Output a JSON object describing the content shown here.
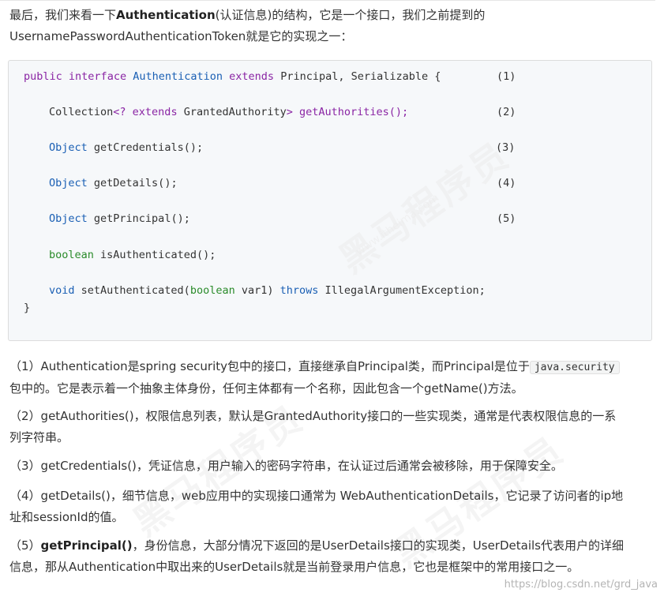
{
  "intro": {
    "part1": "最后，我们来看一下",
    "bold": "Authentication",
    "part2": "(认证信息)的结构，它是一个接口，我们之前提到的",
    "line2": "UsernamePasswordAuthenticationToken就是它的实现之一："
  },
  "code": {
    "l1": {
      "kw1": "public",
      "kw2": "interface",
      "type": "Authentication",
      "kw3": "extends",
      "rest": "Principal, Serializable {",
      "num": "(1)"
    },
    "l2": {
      "a": "Collection",
      "b": "<? ",
      "kw": "extends",
      "c": " GrantedAuthority",
      "d": "> getAuthorities();",
      "num": "(2)"
    },
    "l3": {
      "type": "Object",
      "rest": " getCredentials();",
      "num": "(3)"
    },
    "l4": {
      "type": "Object",
      "rest": " getDetails();",
      "num": "(4)"
    },
    "l5": {
      "type": "Object",
      "rest": " getPrincipal();",
      "num": "(5)"
    },
    "l6": {
      "type": "boolean",
      "rest": " isAuthenticated();"
    },
    "l7": {
      "type": "void",
      "rest1": " setAuthenticated(",
      "type2": "boolean",
      "rest2": " var1) ",
      "kw": "throws",
      "rest3": " IllegalArgumentException;"
    },
    "l8": "}"
  },
  "explanations": {
    "e1": {
      "a": "（1）Authentication是spring security包中的接口，直接继承自Principal类，而Principal是位于",
      "code": "java.security",
      "b": "包中的。它是表示着一个抽象主体身份，任何主体都有一个名称，因此包含一个getName()方法。"
    },
    "e2": {
      "a": "（2）getAuthorities()，权限信息列表，默认是GrantedAuthority接口的一些实现类，通常是代表权限信息的一系",
      "b": "列字符串。"
    },
    "e3": "（3）getCredentials()，凭证信息，用户输入的密码字符串，在认证过后通常会被移除，用于保障安全。",
    "e4": {
      "a": "（4）getDetails()，细节信息，web应用中的实现接口通常为 WebAuthenticationDetails，它记录了访问者的ip地",
      "b": "址和sessionId的值。"
    },
    "e5": {
      "num": "（5）",
      "bold": "getPrincipal()",
      "a": "，身份信息，大部分情况下返回的是UserDetails接口的实现类，UserDetails代表用户的详细",
      "b": "信息，那从Authentication中取出来的UserDetails就是当前登录用户信息，它也是框架中的常用接口之一。"
    }
  },
  "footer": {
    "url": "https://blog.csdn.net/grd_java"
  }
}
